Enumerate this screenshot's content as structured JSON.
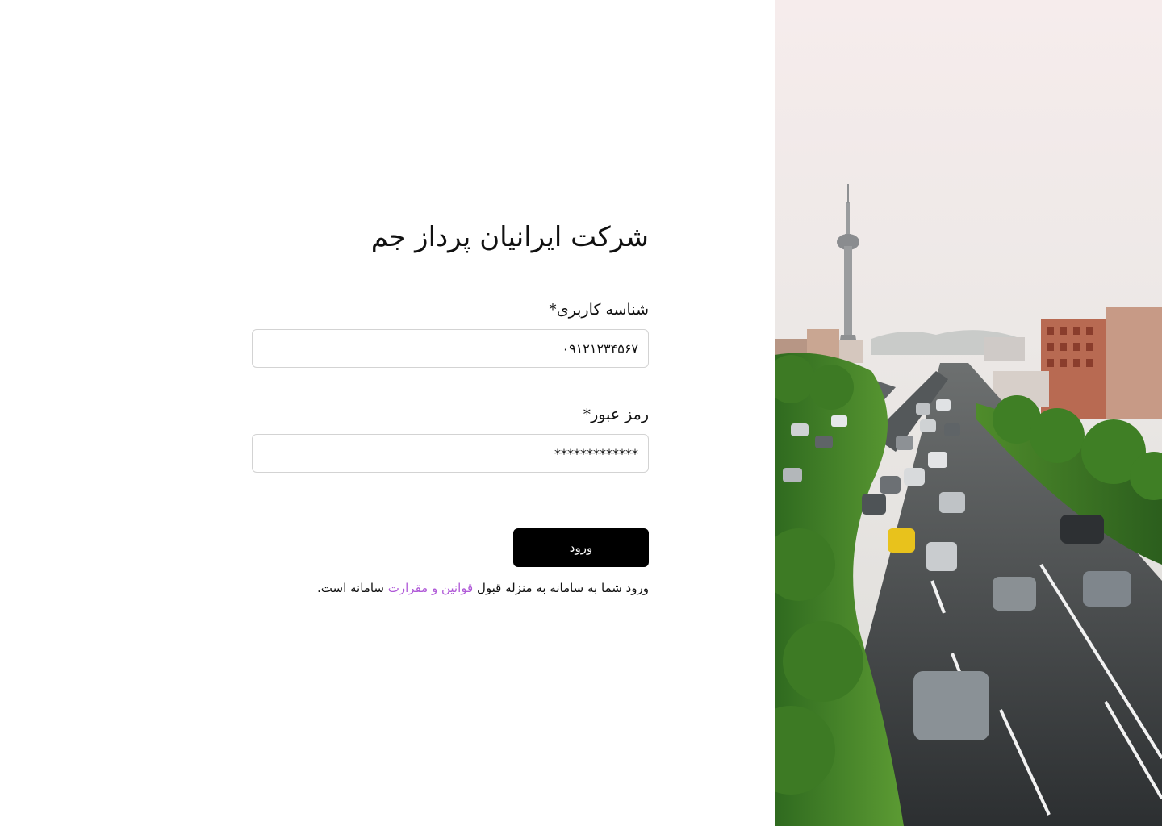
{
  "company": {
    "title": "شرکت ایرانیان پرداز جم"
  },
  "form": {
    "username_label": "شناسه کاربری*",
    "username_value": "۰۹۱۲۱۲۳۴۵۶۷",
    "password_label": "رمز عبور*",
    "password_value": "*************",
    "login_label": "ورود"
  },
  "terms": {
    "prefix": "ورود شما به سامانه به منزله قبول",
    "link_text": "قوانین و مقرارت",
    "suffix": "سامانه است."
  },
  "photo": {
    "description_icon": "city-highway-photo"
  },
  "colors": {
    "primary_button": "#000000",
    "link": "#b05ad8",
    "input_border": "#d3d3d3"
  }
}
